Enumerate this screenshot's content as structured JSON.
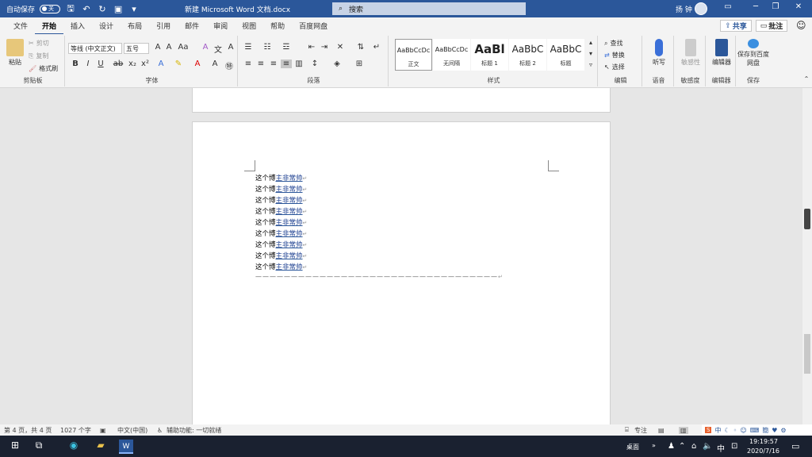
{
  "titlebar": {
    "autosave_label": "自动保存",
    "autosave_state": "关",
    "doc_title": "新建 Microsoft Word 文档.docx",
    "search_placeholder": "搜索",
    "user_name": "扬 钟",
    "accent": "#2b579a"
  },
  "menu": {
    "tabs": [
      "文件",
      "开始",
      "插入",
      "设计",
      "布局",
      "引用",
      "邮件",
      "审阅",
      "视图",
      "帮助",
      "百度网盘"
    ],
    "share_label": "共享",
    "comment_label": "批注"
  },
  "ribbon": {
    "clipboard": {
      "paste": "粘贴",
      "cut": "剪切",
      "copy": "复制",
      "format_painter": "格式刷",
      "label": "剪贴板"
    },
    "font": {
      "font_name": "等线 (中文正文)",
      "font_size": "五号",
      "label": "字体"
    },
    "paragraph": {
      "label": "段落"
    },
    "styles": {
      "items": [
        {
          "preview": "AaBbCcDc",
          "name": "正文"
        },
        {
          "preview": "AaBbCcDc",
          "name": "无间隔"
        },
        {
          "preview": "AaBl",
          "name": "标题 1"
        },
        {
          "preview": "AaBbC",
          "name": "标题 2"
        },
        {
          "preview": "AaBbC",
          "name": "标题"
        }
      ],
      "label": "样式"
    },
    "editing": {
      "find": "查找",
      "replace": "替换",
      "select": "选择",
      "label": "编辑"
    },
    "voice": {
      "dictate": "听写",
      "label": "语音"
    },
    "sensitivity": {
      "btn": "敏感性",
      "label": "敏感度"
    },
    "editor": {
      "btn": "编辑器",
      "label": "编辑器"
    },
    "save": {
      "btn": "保存到百度网盘",
      "label": "保存"
    }
  },
  "document": {
    "lines": [
      {
        "pre": "这个博",
        "u": "主非常帅"
      },
      {
        "pre": "这个博",
        "u": "主非常帅"
      },
      {
        "pre": "这个博",
        "u": "主非常帅"
      },
      {
        "pre": "这个博",
        "u": "主非常帅"
      },
      {
        "pre": "这个博",
        "u": "主非常帅"
      },
      {
        "pre": "这个博",
        "u": "主非常帅"
      },
      {
        "pre": "这个博",
        "u": "主非常帅"
      },
      {
        "pre": "这个博",
        "u": "主非常帅"
      },
      {
        "pre": "这个博",
        "u": "主非常帅"
      }
    ],
    "separator": "——————————————————————————————————",
    "para_mark": "↵"
  },
  "status": {
    "page": "第 4 页，共 4 页",
    "words": "1027 个字",
    "lang": "中文(中国)",
    "accessibility": "辅助功能: 一切就绪",
    "focus": "专注",
    "ime_lang": "中"
  },
  "taskbar": {
    "desktop_label": "桌面",
    "ime": "中",
    "time": "19:19:57",
    "date": "2020/7/16"
  }
}
